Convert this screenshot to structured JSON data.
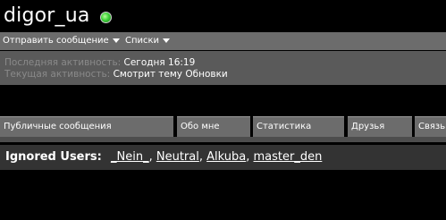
{
  "profile": {
    "username": "digor_ua",
    "status_icon": "online-dot-icon",
    "status_color": "#3fd13a"
  },
  "actions": {
    "send_message": "Отправить сообщение",
    "lists": "Списки"
  },
  "activity": {
    "last_label": "Последняя активность:",
    "last_value": "Сегодня 16:19",
    "current_label": "Текущая активность:",
    "current_value": "Смотрит тему Обновки"
  },
  "tabs": [
    {
      "label": "Публичные сообщения"
    },
    {
      "label": "Обо мне"
    },
    {
      "label": "Статистика"
    },
    {
      "label": "Друзья"
    },
    {
      "label": "Связь"
    }
  ],
  "ignored": {
    "title": "Ignored Users:",
    "users": [
      "_Nein_",
      "Neutral",
      "Alkuba",
      "master_den"
    ],
    "separator": ","
  }
}
